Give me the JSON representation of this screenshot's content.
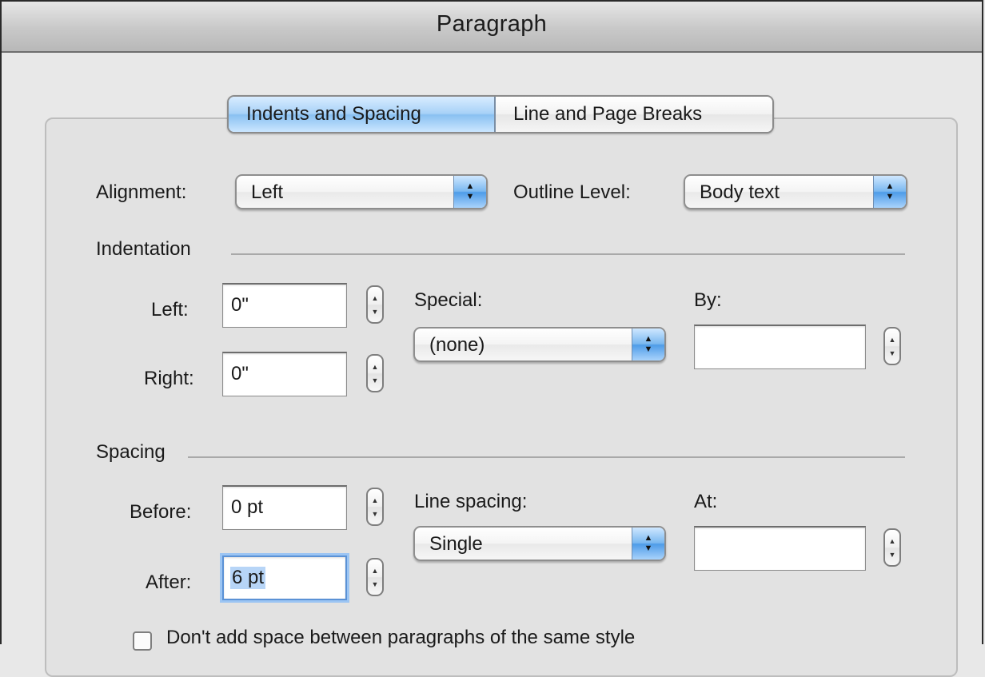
{
  "window": {
    "title": "Paragraph"
  },
  "tabs": [
    {
      "label": "Indents and Spacing",
      "active": true
    },
    {
      "label": "Line and Page Breaks",
      "active": false
    }
  ],
  "general": {
    "alignment_label": "Alignment:",
    "alignment_value": "Left",
    "outline_label": "Outline Level:",
    "outline_value": "Body text"
  },
  "indentation": {
    "section_label": "Indentation",
    "left_label": "Left:",
    "left_value": "0\"",
    "right_label": "Right:",
    "right_value": "0\"",
    "special_label": "Special:",
    "special_value": "(none)",
    "by_label": "By:",
    "by_value": ""
  },
  "spacing": {
    "section_label": "Spacing",
    "before_label": "Before:",
    "before_value": "0 pt",
    "after_label": "After:",
    "after_value": "6 pt",
    "line_spacing_label": "Line spacing:",
    "line_spacing_value": "Single",
    "at_label": "At:",
    "at_value": ""
  },
  "options": {
    "dont_add_space_label": "Don't add space between paragraphs of the same style",
    "dont_add_space_checked": false
  },
  "colors": {
    "accent_blue": "#6fb0ee",
    "focus_ring": "#9cc5f3",
    "dialog_bg": "#e8e8e8"
  }
}
